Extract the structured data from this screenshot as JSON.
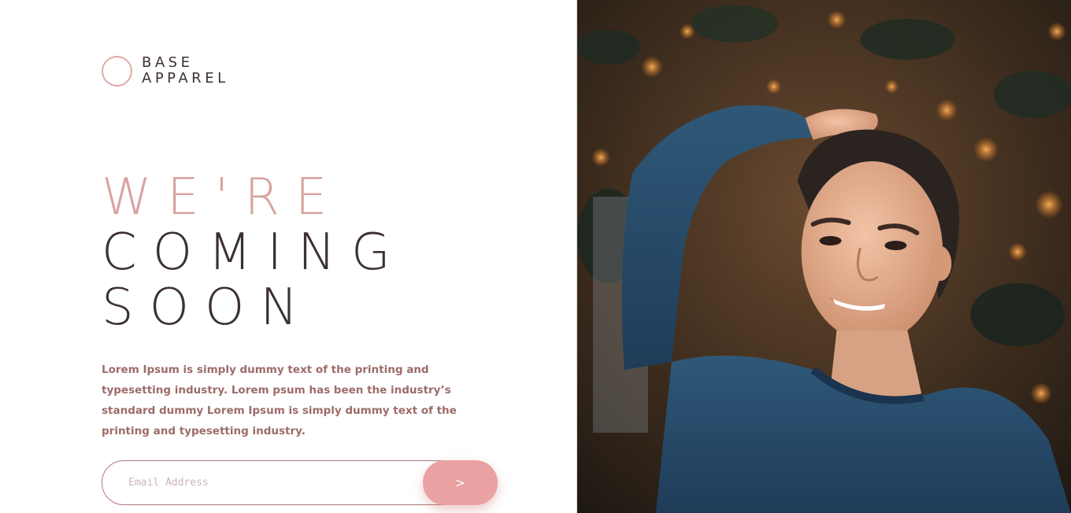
{
  "brand": {
    "line1": "BASE",
    "line2": "APPAREL",
    "circle_color": "#e3a8a6"
  },
  "headline": {
    "line1": "WE'RE",
    "line2": "COMING",
    "line3": "SOON"
  },
  "description": "Lorem Ipsum is simply dummy text of the printing and typesetting industry. Lorem psum has been the industry’s standard dummy Lorem Ipsum is simply dummy text of the printing and typesetting industry.",
  "form": {
    "email_placeholder": "Email Address",
    "email_value": "",
    "submit_label": ">"
  },
  "colors": {
    "accent": "#e9a1a1",
    "dark_text": "#3c3032",
    "body_text": "#9c6c6a"
  },
  "hero_image": {
    "icon": "portrait-photo"
  }
}
